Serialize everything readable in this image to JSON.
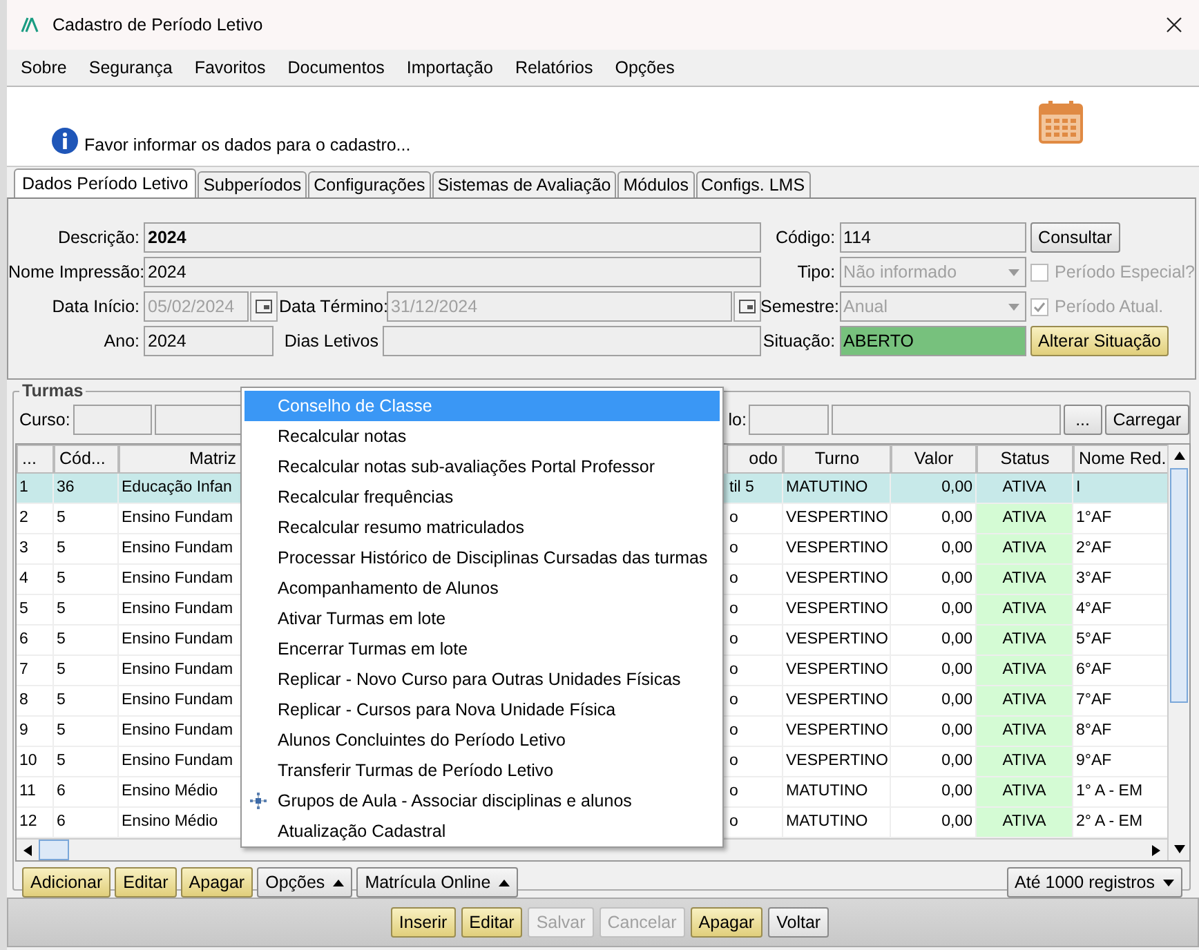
{
  "window": {
    "title": "Cadastro de Período Letivo"
  },
  "menu_bar": [
    "Sobre",
    "Segurança",
    "Favoritos",
    "Documentos",
    "Importação",
    "Relatórios",
    "Opções"
  ],
  "info_message": "Favor informar os dados para o cadastro...",
  "tabs": [
    {
      "label": "Dados Período Letivo",
      "selected": true
    },
    {
      "label": "Subperíodos",
      "selected": false
    },
    {
      "label": "Configurações",
      "selected": false
    },
    {
      "label": "Sistemas de Avaliação",
      "selected": false
    },
    {
      "label": "Módulos",
      "selected": false
    },
    {
      "label": "Configs. LMS",
      "selected": false
    }
  ],
  "form": {
    "descricao": {
      "label": "Descrição:",
      "value": "2024"
    },
    "nome_impressao": {
      "label": "Nome Impressão:",
      "value": "2024"
    },
    "data_inicio": {
      "label": "Data Início:",
      "value": "05/02/2024",
      "disabled": true
    },
    "data_termino": {
      "label": "Data Término:",
      "value": "31/12/2024",
      "disabled": true
    },
    "ano": {
      "label": "Ano:",
      "value": "2024"
    },
    "dias_letivos": {
      "label": "Dias Letivos"
    },
    "codigo": {
      "label": "Código:",
      "value": "114"
    },
    "tipo": {
      "label": "Tipo:",
      "value": "Não informado",
      "disabled": true
    },
    "semestre": {
      "label": "Semestre:",
      "value": "Anual",
      "disabled": true
    },
    "situacao": {
      "label": "Situação:",
      "value": "ABERTO",
      "highlighted": true
    },
    "consultar_button": "Consultar",
    "periodo_especial": {
      "label": "Período Especial?",
      "checked": false,
      "disabled": true
    },
    "periodo_atual": {
      "label": "Período Atual.",
      "checked": true,
      "disabled": true
    },
    "alterar_situacao_button": "Alterar Situação"
  },
  "turmas": {
    "title": "Turmas",
    "curso_label": "Curso:",
    "filter_label": "lo:",
    "browse_button": "...",
    "load_button": "Carregar",
    "columns": [
      "...",
      "Cód...",
      "Matriz",
      "odo",
      "Turno",
      "Valor",
      "Status",
      "Nome Red."
    ],
    "rows": [
      {
        "selected": true,
        "cells": [
          "1",
          "36",
          "Educação Infan",
          "til 5",
          "MATUTINO",
          "0,00",
          "ATIVA",
          "I"
        ]
      },
      {
        "selected": false,
        "cells": [
          "2",
          "5",
          "Ensino Fundam",
          "o",
          "VESPERTINO",
          "0,00",
          "ATIVA",
          "1°AF"
        ]
      },
      {
        "selected": false,
        "cells": [
          "3",
          "5",
          "Ensino Fundam",
          "o",
          "VESPERTINO",
          "0,00",
          "ATIVA",
          "2°AF"
        ]
      },
      {
        "selected": false,
        "cells": [
          "4",
          "5",
          "Ensino Fundam",
          "o",
          "VESPERTINO",
          "0,00",
          "ATIVA",
          "3°AF"
        ]
      },
      {
        "selected": false,
        "cells": [
          "5",
          "5",
          "Ensino Fundam",
          "o",
          "VESPERTINO",
          "0,00",
          "ATIVA",
          "4°AF"
        ]
      },
      {
        "selected": false,
        "cells": [
          "6",
          "5",
          "Ensino Fundam",
          "o",
          "VESPERTINO",
          "0,00",
          "ATIVA",
          "5°AF"
        ]
      },
      {
        "selected": false,
        "cells": [
          "7",
          "5",
          "Ensino Fundam",
          "o",
          "VESPERTINO",
          "0,00",
          "ATIVA",
          "6°AF"
        ]
      },
      {
        "selected": false,
        "cells": [
          "8",
          "5",
          "Ensino Fundam",
          "o",
          "VESPERTINO",
          "0,00",
          "ATIVA",
          "7°AF"
        ]
      },
      {
        "selected": false,
        "cells": [
          "9",
          "5",
          "Ensino Fundam",
          "o",
          "VESPERTINO",
          "0,00",
          "ATIVA",
          "8°AF"
        ]
      },
      {
        "selected": false,
        "cells": [
          "10",
          "5",
          "Ensino Fundam",
          "o",
          "VESPERTINO",
          "0,00",
          "ATIVA",
          "9°AF"
        ]
      },
      {
        "selected": false,
        "cells": [
          "11",
          "6",
          "Ensino Médio",
          "o",
          "MATUTINO",
          "0,00",
          "ATIVA",
          "1° A - EM"
        ]
      },
      {
        "selected": false,
        "cells": [
          "12",
          "6",
          "Ensino Médio",
          "o",
          "MATUTINO",
          "0,00",
          "ATIVA",
          "2° A - EM"
        ]
      }
    ],
    "grid_buttons": [
      {
        "label": "Adicionar",
        "kind": "action"
      },
      {
        "label": "Editar",
        "kind": "action"
      },
      {
        "label": "Apagar",
        "kind": "action"
      },
      {
        "label": "Opções",
        "kind": "dropdown"
      },
      {
        "label": "Matrícula Online",
        "kind": "dropdown"
      }
    ],
    "records_select": "Até 1000 registros"
  },
  "context_menu": [
    {
      "label": "Conselho de Classe",
      "selected": true,
      "has_icon": false
    },
    {
      "label": "Recalcular notas",
      "selected": false,
      "has_icon": false
    },
    {
      "label": "Recalcular notas sub-avaliações Portal Professor",
      "selected": false,
      "has_icon": false
    },
    {
      "label": "Recalcular frequências",
      "selected": false,
      "has_icon": false
    },
    {
      "label": "Recalcular resumo matriculados",
      "selected": false,
      "has_icon": false
    },
    {
      "label": "Processar Histórico de Disciplinas Cursadas das turmas",
      "selected": false,
      "has_icon": false
    },
    {
      "label": "Acompanhamento de Alunos",
      "selected": false,
      "has_icon": false
    },
    {
      "label": "Ativar Turmas em lote",
      "selected": false,
      "has_icon": false
    },
    {
      "label": "Encerrar Turmas em lote",
      "selected": false,
      "has_icon": false
    },
    {
      "label": "Replicar - Novo Curso para Outras Unidades Físicas",
      "selected": false,
      "has_icon": false
    },
    {
      "label": "Replicar - Cursos para Nova Unidade Física",
      "selected": false,
      "has_icon": false
    },
    {
      "label": "Alunos Concluintes do Período Letivo",
      "selected": false,
      "has_icon": false
    },
    {
      "label": "Transferir Turmas de Período Letivo",
      "selected": false,
      "has_icon": false
    },
    {
      "label": "Grupos de Aula - Associar disciplinas e alunos",
      "selected": false,
      "has_icon": true
    },
    {
      "label": "Atualização Cadastral",
      "selected": false,
      "has_icon": false
    }
  ],
  "footer_buttons": [
    {
      "label": "Inserir",
      "kind": "action",
      "disabled": false
    },
    {
      "label": "Editar",
      "kind": "action",
      "disabled": false
    },
    {
      "label": "Salvar",
      "kind": "action",
      "disabled": true
    },
    {
      "label": "Cancelar",
      "kind": "plain",
      "disabled": true
    },
    {
      "label": "Apagar",
      "kind": "action",
      "disabled": false
    },
    {
      "label": "Voltar",
      "kind": "plain",
      "disabled": false
    }
  ]
}
